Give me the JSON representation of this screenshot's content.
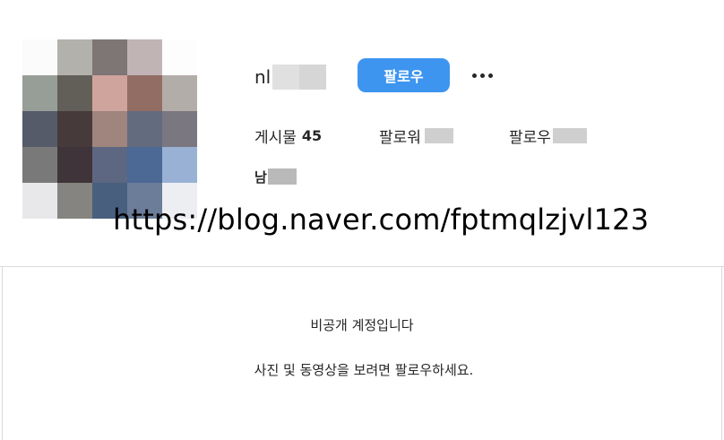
{
  "profile": {
    "username_visible": "nl",
    "follow_label": "팔로우",
    "more_icon": "more-horizontal-icon",
    "stats": {
      "posts_label": "게시물",
      "posts_count": "45",
      "followers_label": "팔로워",
      "following_label": "팔로우"
    },
    "fullname_visible": "남"
  },
  "overlay": {
    "blog_url": "https://blog.naver.com/fptmqlzjvl123"
  },
  "private_notice": {
    "title": "비공개 계정입니다",
    "description": "사진 및 동영상을 보려면 팔로우하세요."
  },
  "avatar_mosaic": [
    [
      "#fbfbfb",
      "#b3b1ab",
      "#7e7575",
      "#c0b4b5",
      "#fdfdfd"
    ],
    [
      "#979e98",
      "#625f58",
      "#cfa49c",
      "#926d63",
      "#b3adaa"
    ],
    [
      "#555b68",
      "#473a3b",
      "#a0847e",
      "#636b7f",
      "#7b7780"
    ],
    [
      "#7a7979",
      "#3f3439",
      "#5d6782",
      "#4c6894",
      "#99b1d4"
    ],
    [
      "#e8e8ea",
      "#858480",
      "#495f7e",
      "#6b7d99",
      "#eceef2"
    ]
  ],
  "colors": {
    "follow_button": "#3d95f0",
    "text": "#262626",
    "divider": "#dbdbdb"
  }
}
